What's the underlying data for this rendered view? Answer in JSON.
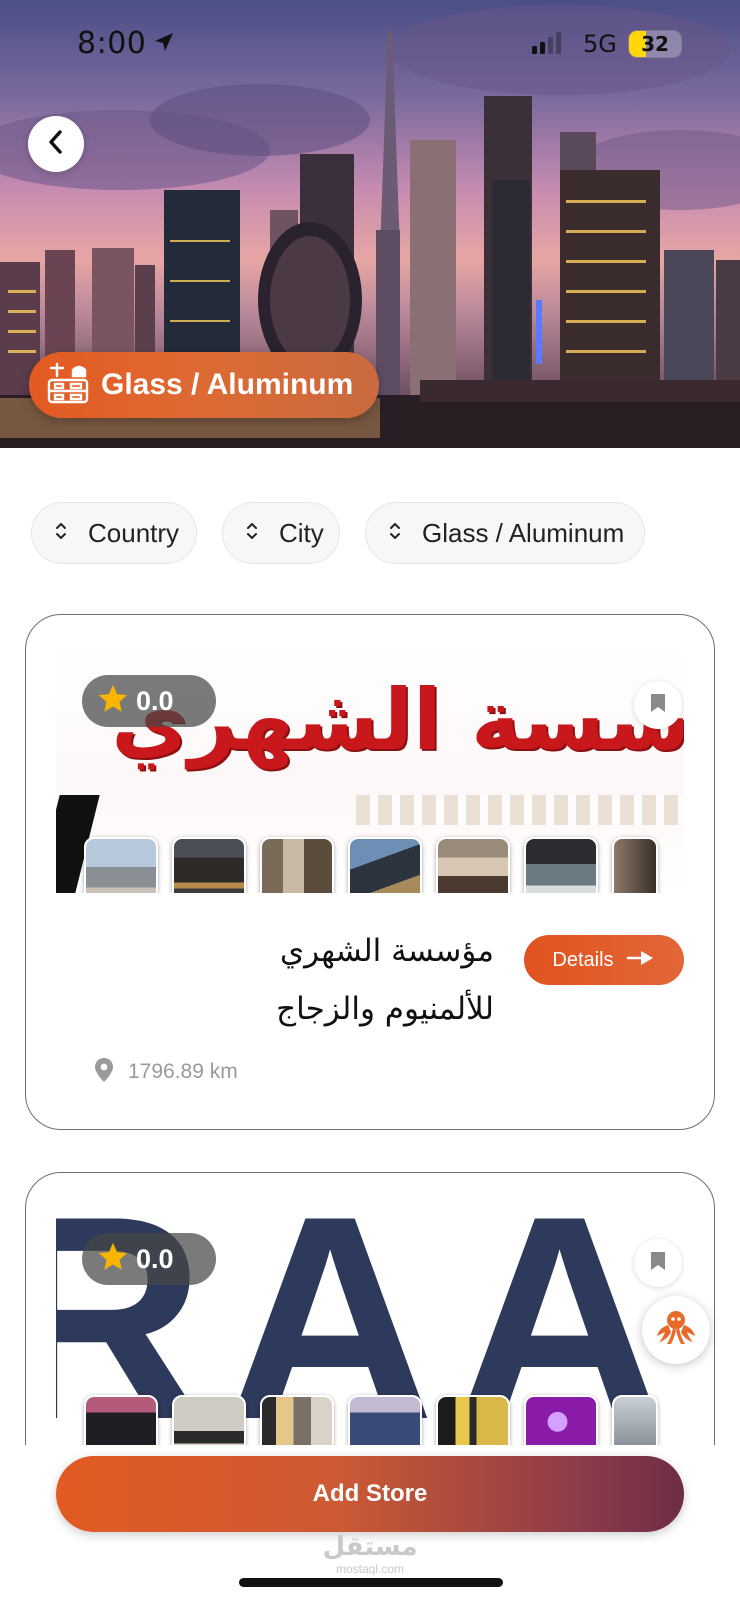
{
  "status_bar": {
    "time": "8:00",
    "network": "5G",
    "battery": "32",
    "battery_level": 0.32
  },
  "hero": {
    "category_label": "Glass / Aluminum",
    "category_icon": "workbench-icon",
    "back_icon": "chevron-left-icon"
  },
  "filters": [
    {
      "label": "Country",
      "icon": "sort-chevrons-icon"
    },
    {
      "label": "City",
      "icon": "sort-chevrons-icon"
    },
    {
      "label": "Glass / Aluminum",
      "icon": "sort-chevrons-icon"
    }
  ],
  "stores": [
    {
      "rating": "0.0",
      "banner_text": "سسة الشهري",
      "name_line1": "مؤسسة الشهري",
      "name_line2": "للألمنيوم والزجاج",
      "details_label": "Details",
      "distance": "1796.89 km"
    },
    {
      "rating": "0.0",
      "banner_text": "RAA"
    }
  ],
  "actions": {
    "add_store_label": "Add Store"
  },
  "watermark": {
    "arabic": "مستقل",
    "latin": "mostaql.com"
  },
  "colors": {
    "accent": "#e35a22",
    "accent_dark": "#6d2d44",
    "star": "#f7b500"
  }
}
